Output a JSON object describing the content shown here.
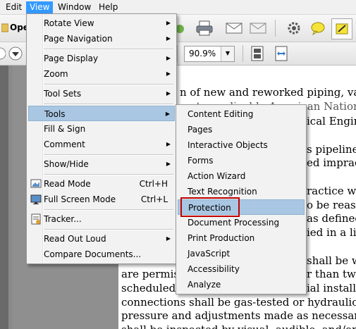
{
  "menubar": {
    "items": [
      {
        "label": "Edit"
      },
      {
        "label": "View"
      },
      {
        "label": "Window"
      },
      {
        "label": "Help"
      }
    ]
  },
  "toolbar": {
    "open_label": "Ope",
    "zoom_value": "90.9%"
  },
  "document": {
    "lines": [
      "n of new and reworked piping, valves, p",
      "on to applicable American National St",
      "ical Engine",
      "s pipelines",
      "ed impractic",
      "ractice will",
      "o be reasona",
      "as defined",
      "ied in a list",
      "shall be we",
      "are permiss",
      "r than two-",
      "scheduled c",
      "ial installat",
      "connections shall be gas-tested or hydraulically-te",
      "pressure and adjustments made as necessary to obta",
      "shall be inspected by visual, audible, and/or olfact"
    ]
  },
  "view_menu": {
    "items": [
      {
        "label": "Rotate View",
        "arrow": "▶"
      },
      {
        "label": "Page Navigation",
        "arrow": "▶"
      },
      {
        "label": "Page Display",
        "arrow": "▶"
      },
      {
        "label": "Zoom",
        "arrow": "▶"
      },
      {
        "label": "Tool Sets",
        "arrow": "▶"
      },
      {
        "label": "Tools",
        "arrow": "▶"
      },
      {
        "label": "Fill & Sign"
      },
      {
        "label": "Comment",
        "arrow": "▶"
      },
      {
        "label": "Show/Hide",
        "arrow": "▶"
      },
      {
        "label": "Read Mode",
        "shortcut": "Ctrl+H"
      },
      {
        "label": "Full Screen Mode",
        "shortcut": "Ctrl+L"
      },
      {
        "label": "Tracker..."
      },
      {
        "label": "Read Out Loud",
        "arrow": "▶"
      },
      {
        "label": "Compare Documents..."
      }
    ]
  },
  "tools_submenu": {
    "items": [
      {
        "label": "Content Editing"
      },
      {
        "label": "Pages"
      },
      {
        "label": "Interactive Objects"
      },
      {
        "label": "Forms"
      },
      {
        "label": "Action Wizard"
      },
      {
        "label": "Text Recognition"
      },
      {
        "label": "Protection"
      },
      {
        "label": "Document Processing"
      },
      {
        "label": "Print Production"
      },
      {
        "label": "JavaScript"
      },
      {
        "label": "Accessibility"
      },
      {
        "label": "Analyze"
      }
    ]
  },
  "colors": {
    "menu_highlight": "#a9c7e2",
    "menubar_active": "#3399ff",
    "callout_border": "#c00000"
  }
}
